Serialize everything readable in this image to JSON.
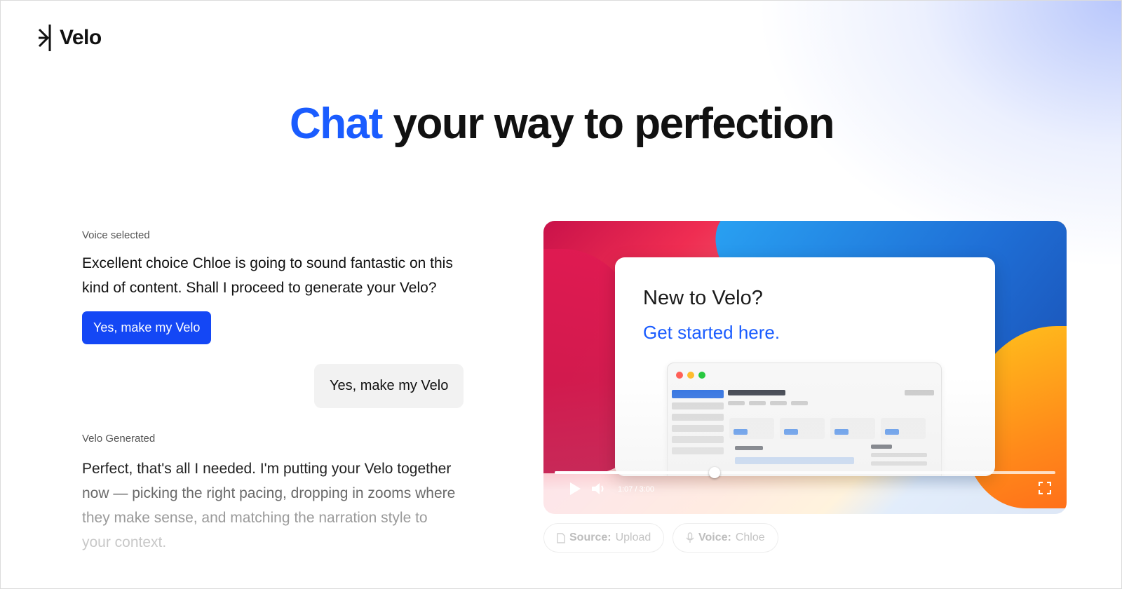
{
  "brand": {
    "name": "Velo"
  },
  "headline": {
    "accent": "Chat",
    "rest": " your way to perfection"
  },
  "chat": {
    "voice_label": "Voice selected",
    "bot_message": "Excellent choice Chloe is going to sound fantastic on this kind of content. Shall I proceed to generate your Velo?",
    "confirm_button": "Yes, make my Velo",
    "user_reply": "Yes, make my Velo",
    "generated_label": "Velo Generated",
    "generated_lines": [
      "Perfect, that's all I needed. I'm putting your Velo together",
      "now — picking the right pacing, dropping in zooms where",
      "they make sense, and matching the narration style to",
      "your context."
    ]
  },
  "video": {
    "card_title": "New to Velo?",
    "card_link": "Get started here.",
    "time": "1:07 / 3:00",
    "progress": 0.32
  },
  "chips": {
    "source_key": "Source:",
    "source_value": "Upload",
    "voice_key": "Voice:",
    "voice_value": "Chloe"
  },
  "icons": [
    "velo-logo-icon",
    "play-icon",
    "volume-icon",
    "fullscreen-icon",
    "document-icon",
    "microphone-icon"
  ],
  "colors": {
    "accent": "#1a5cff",
    "button": "#1447f5"
  }
}
